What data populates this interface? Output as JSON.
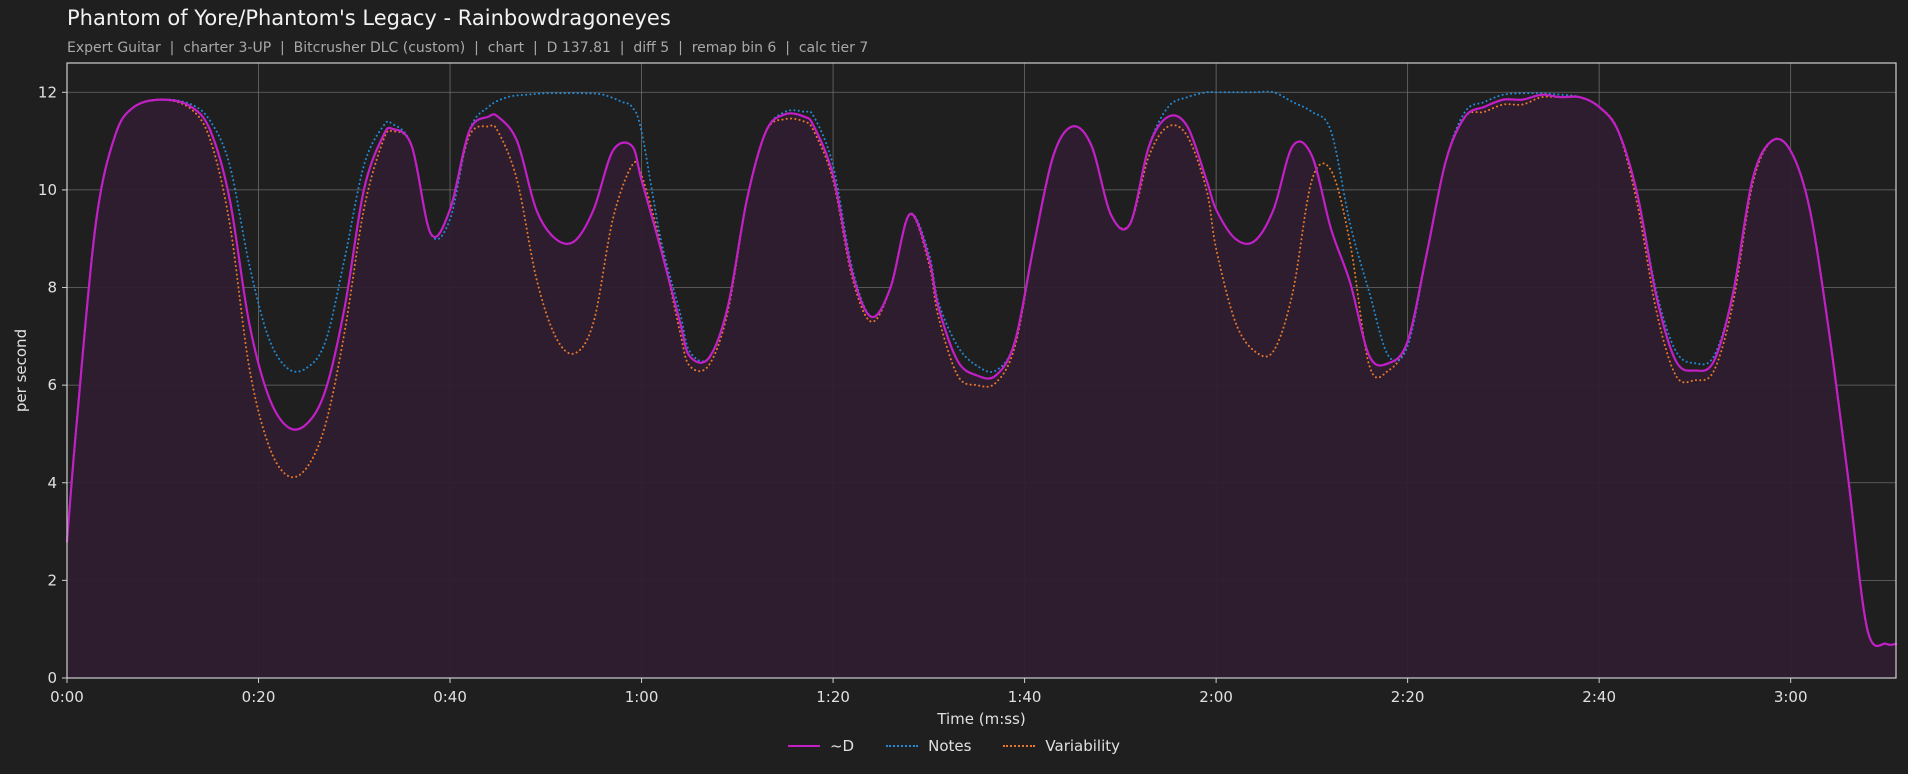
{
  "colors": {
    "background": "#1f1f1f",
    "fill": "#2e1d2f",
    "d": "#c21fc6",
    "notes": "#2189d6",
    "variability": "#e8772a",
    "grid": "#6b6b6b"
  },
  "chart_data": {
    "type": "line",
    "title": "Phantom of Yore/Phantom's Legacy - Rainbowdragoneyes",
    "subtitle": "Expert Guitar  |  charter 3-UP  |  Bitcrusher DLC (custom)  |  chart  |  D 137.81  |  diff 5  |  remap bin 6  |  calc tier 7",
    "xlabel": "Time (m:ss)",
    "ylabel": "per second",
    "xlim": [
      0,
      191
    ],
    "ylim": [
      0,
      12.6
    ],
    "xticks": [
      0,
      20,
      40,
      60,
      80,
      100,
      120,
      140,
      160,
      180
    ],
    "xtick_labels": [
      "0:00",
      "0:20",
      "0:40",
      "1:00",
      "1:20",
      "1:40",
      "2:00",
      "2:20",
      "2:40",
      "3:00"
    ],
    "yticks": [
      0,
      2,
      4,
      6,
      8,
      10,
      12
    ],
    "ytick_labels": [
      "0",
      "2",
      "4",
      "6",
      "8",
      "10",
      "12"
    ],
    "grid": true,
    "legend_position": "bottom-center",
    "fill_under": "~D",
    "series": [
      {
        "name": "~D",
        "style": "solid",
        "x": [
          0,
          1,
          3,
          5,
          7,
          10,
          13,
          15,
          17,
          19,
          21,
          23,
          25,
          27,
          29,
          31,
          33,
          34,
          36,
          38,
          40,
          42,
          44,
          45,
          47,
          49,
          51,
          53,
          55,
          57,
          59,
          60,
          62,
          64,
          65,
          67,
          69,
          71,
          73,
          75,
          77,
          78,
          80,
          82,
          84,
          86,
          88,
          90,
          91,
          93,
          95,
          97,
          99,
          101,
          103,
          105,
          107,
          109,
          111,
          113,
          115,
          117,
          119,
          120,
          122,
          124,
          126,
          128,
          130,
          132,
          134,
          136,
          138,
          140,
          142,
          144,
          146,
          148,
          150,
          152,
          154,
          156,
          158,
          160,
          162,
          164,
          166,
          168,
          170,
          172,
          174,
          176,
          178,
          180,
          182,
          184,
          186,
          188,
          190,
          191
        ],
        "y": [
          2.8,
          5.2,
          9.3,
          11.1,
          11.7,
          11.85,
          11.7,
          11.2,
          9.8,
          7.3,
          5.8,
          5.15,
          5.2,
          5.9,
          7.6,
          10.0,
          11.1,
          11.25,
          10.9,
          9.1,
          9.6,
          11.2,
          11.5,
          11.5,
          11.0,
          9.6,
          9.0,
          8.95,
          9.6,
          10.8,
          10.9,
          10.2,
          8.8,
          7.3,
          6.6,
          6.55,
          7.6,
          9.8,
          11.2,
          11.55,
          11.5,
          11.3,
          10.3,
          8.3,
          7.4,
          8.0,
          9.5,
          8.6,
          7.6,
          6.5,
          6.2,
          6.2,
          6.9,
          8.9,
          10.7,
          11.3,
          10.9,
          9.5,
          9.3,
          10.9,
          11.5,
          11.3,
          10.2,
          9.6,
          9.0,
          8.95,
          9.6,
          10.9,
          10.7,
          9.2,
          8.1,
          6.6,
          6.45,
          6.9,
          8.7,
          10.6,
          11.5,
          11.7,
          11.85,
          11.85,
          11.95,
          11.9,
          11.9,
          11.7,
          11.2,
          9.9,
          7.8,
          6.5,
          6.3,
          6.5,
          7.9,
          10.2,
          11.0,
          10.8,
          9.6,
          7.1,
          4.1,
          1.0,
          0.7,
          0.7
        ]
      },
      {
        "name": "Notes",
        "style": "dotted",
        "x": [
          0,
          1,
          3,
          5,
          7,
          10,
          13,
          15,
          17,
          19,
          21,
          23,
          25,
          27,
          29,
          31,
          33,
          34,
          36,
          38,
          40,
          42,
          44,
          46,
          48,
          50,
          52,
          54,
          56,
          58,
          59,
          60,
          62,
          64,
          65,
          67,
          69,
          71,
          73,
          75,
          77,
          78,
          80,
          82,
          84,
          86,
          88,
          90,
          91,
          93,
          95,
          97,
          99,
          101,
          103,
          105,
          107,
          109,
          111,
          113,
          115,
          117,
          119,
          120,
          122,
          124,
          126,
          128,
          130,
          132,
          134,
          136,
          138,
          140,
          142,
          144,
          146,
          148,
          150,
          152,
          154,
          156,
          158,
          160,
          162,
          164,
          166,
          168,
          170,
          172,
          174,
          176,
          178,
          180,
          182,
          184,
          186,
          188,
          190,
          191
        ],
        "y": [
          2.8,
          5.2,
          9.3,
          11.1,
          11.7,
          11.85,
          11.75,
          11.4,
          10.5,
          8.5,
          7.0,
          6.35,
          6.35,
          6.9,
          8.6,
          10.5,
          11.3,
          11.35,
          10.9,
          9.1,
          9.4,
          11.2,
          11.7,
          11.9,
          11.95,
          11.98,
          11.98,
          11.98,
          11.95,
          11.8,
          11.7,
          11.2,
          9.0,
          7.5,
          6.7,
          6.55,
          7.6,
          9.8,
          11.2,
          11.6,
          11.6,
          11.5,
          10.5,
          8.4,
          7.4,
          8.0,
          9.5,
          8.7,
          7.7,
          6.8,
          6.4,
          6.3,
          6.9,
          8.9,
          10.7,
          11.3,
          10.9,
          9.5,
          9.3,
          10.9,
          11.7,
          11.9,
          12.0,
          12.0,
          12.0,
          12.0,
          12.0,
          11.8,
          11.6,
          11.2,
          9.3,
          7.9,
          6.6,
          6.8,
          8.7,
          10.6,
          11.6,
          11.8,
          11.95,
          11.98,
          11.98,
          11.95,
          11.9,
          11.7,
          11.2,
          9.9,
          7.9,
          6.7,
          6.45,
          6.6,
          7.9,
          10.2,
          11.0,
          10.8,
          9.6,
          7.1,
          4.1,
          1.0,
          0.7,
          0.7
        ]
      },
      {
        "name": "Variability",
        "style": "dotted",
        "x": [
          0,
          1,
          3,
          5,
          7,
          10,
          13,
          15,
          17,
          19,
          21,
          23,
          25,
          27,
          29,
          31,
          33,
          34,
          36,
          38,
          40,
          42,
          44,
          45,
          47,
          49,
          51,
          53,
          55,
          57,
          59,
          60,
          62,
          64,
          65,
          67,
          69,
          71,
          73,
          75,
          77,
          78,
          80,
          82,
          84,
          86,
          88,
          90,
          91,
          93,
          95,
          97,
          99,
          101,
          103,
          105,
          107,
          109,
          111,
          113,
          115,
          117,
          119,
          120,
          122,
          124,
          126,
          128,
          130,
          132,
          134,
          136,
          138,
          140,
          142,
          144,
          146,
          148,
          150,
          152,
          154,
          156,
          158,
          160,
          162,
          164,
          166,
          168,
          170,
          172,
          174,
          176,
          178,
          180,
          182,
          184,
          186,
          188,
          190,
          191
        ],
        "y": [
          2.8,
          5.2,
          9.3,
          11.1,
          11.7,
          11.85,
          11.65,
          11.0,
          9.3,
          6.4,
          4.8,
          4.15,
          4.3,
          5.2,
          7.1,
          9.6,
          11.0,
          11.2,
          10.9,
          9.1,
          9.6,
          11.1,
          11.3,
          11.2,
          10.2,
          8.2,
          7.0,
          6.65,
          7.3,
          9.4,
          10.5,
          10.3,
          8.9,
          7.1,
          6.4,
          6.4,
          7.5,
          9.8,
          11.2,
          11.45,
          11.4,
          11.2,
          10.2,
          8.2,
          7.3,
          8.0,
          9.5,
          8.5,
          7.4,
          6.2,
          6.0,
          6.05,
          6.8,
          8.9,
          10.7,
          11.3,
          10.9,
          9.5,
          9.3,
          10.7,
          11.3,
          11.1,
          10.0,
          8.8,
          7.3,
          6.7,
          6.7,
          7.9,
          10.2,
          10.4,
          8.9,
          6.4,
          6.3,
          6.9,
          8.7,
          10.6,
          11.5,
          11.6,
          11.75,
          11.75,
          11.9,
          11.9,
          11.9,
          11.7,
          11.2,
          9.7,
          7.5,
          6.2,
          6.1,
          6.3,
          7.7,
          10.1,
          11.0,
          10.8,
          9.6,
          7.1,
          4.1,
          1.0,
          0.7,
          0.7
        ]
      }
    ]
  }
}
